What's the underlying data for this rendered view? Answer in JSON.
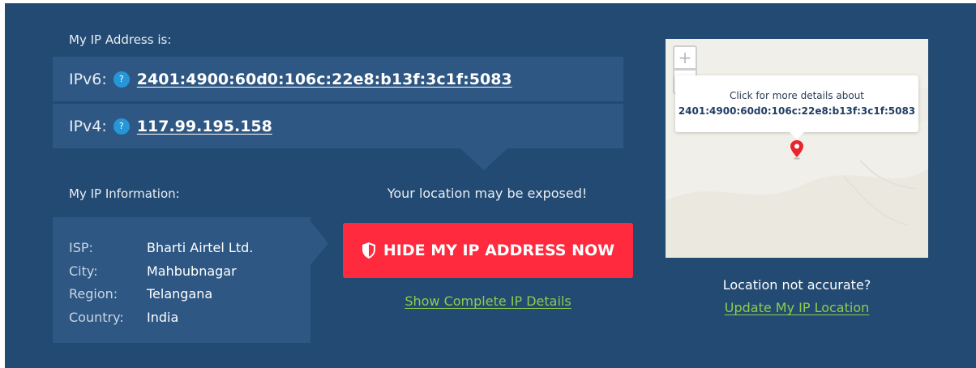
{
  "header": {
    "my_ip_label": "My IP Address is:"
  },
  "ipv6": {
    "label": "IPv6:",
    "help": "?",
    "address": "2401:4900:60d0:106c:22e8:b13f:3c1f:5083"
  },
  "ipv4": {
    "label": "IPv4:",
    "help": "?",
    "address": "117.99.195.158"
  },
  "info": {
    "title": "My IP Information:",
    "rows": [
      {
        "key": "ISP:",
        "value": "Bharti Airtel Ltd."
      },
      {
        "key": "City:",
        "value": "Mahbubnagar"
      },
      {
        "key": "Region:",
        "value": "Telangana"
      },
      {
        "key": "Country:",
        "value": "India"
      }
    ]
  },
  "cta": {
    "exposed_text": "Your location may be exposed!",
    "hide_button": "HIDE MY IP ADDRESS NOW",
    "details_link": "Show Complete IP Details"
  },
  "map": {
    "zoom_in": "+",
    "zoom_out": "−",
    "popup_line1": "Click for more details about",
    "popup_line2": "2401:4900:60d0:106c:22e8:b13f:3c1f:5083"
  },
  "location": {
    "not_accurate": "Location not accurate?",
    "update_link": "Update My IP Location"
  },
  "colors": {
    "panel_bg": "#234a72",
    "row_bg": "#2e5783",
    "accent_red": "#ff2a3d",
    "link_green": "#8fcc4a",
    "help_blue": "#2596d8"
  }
}
